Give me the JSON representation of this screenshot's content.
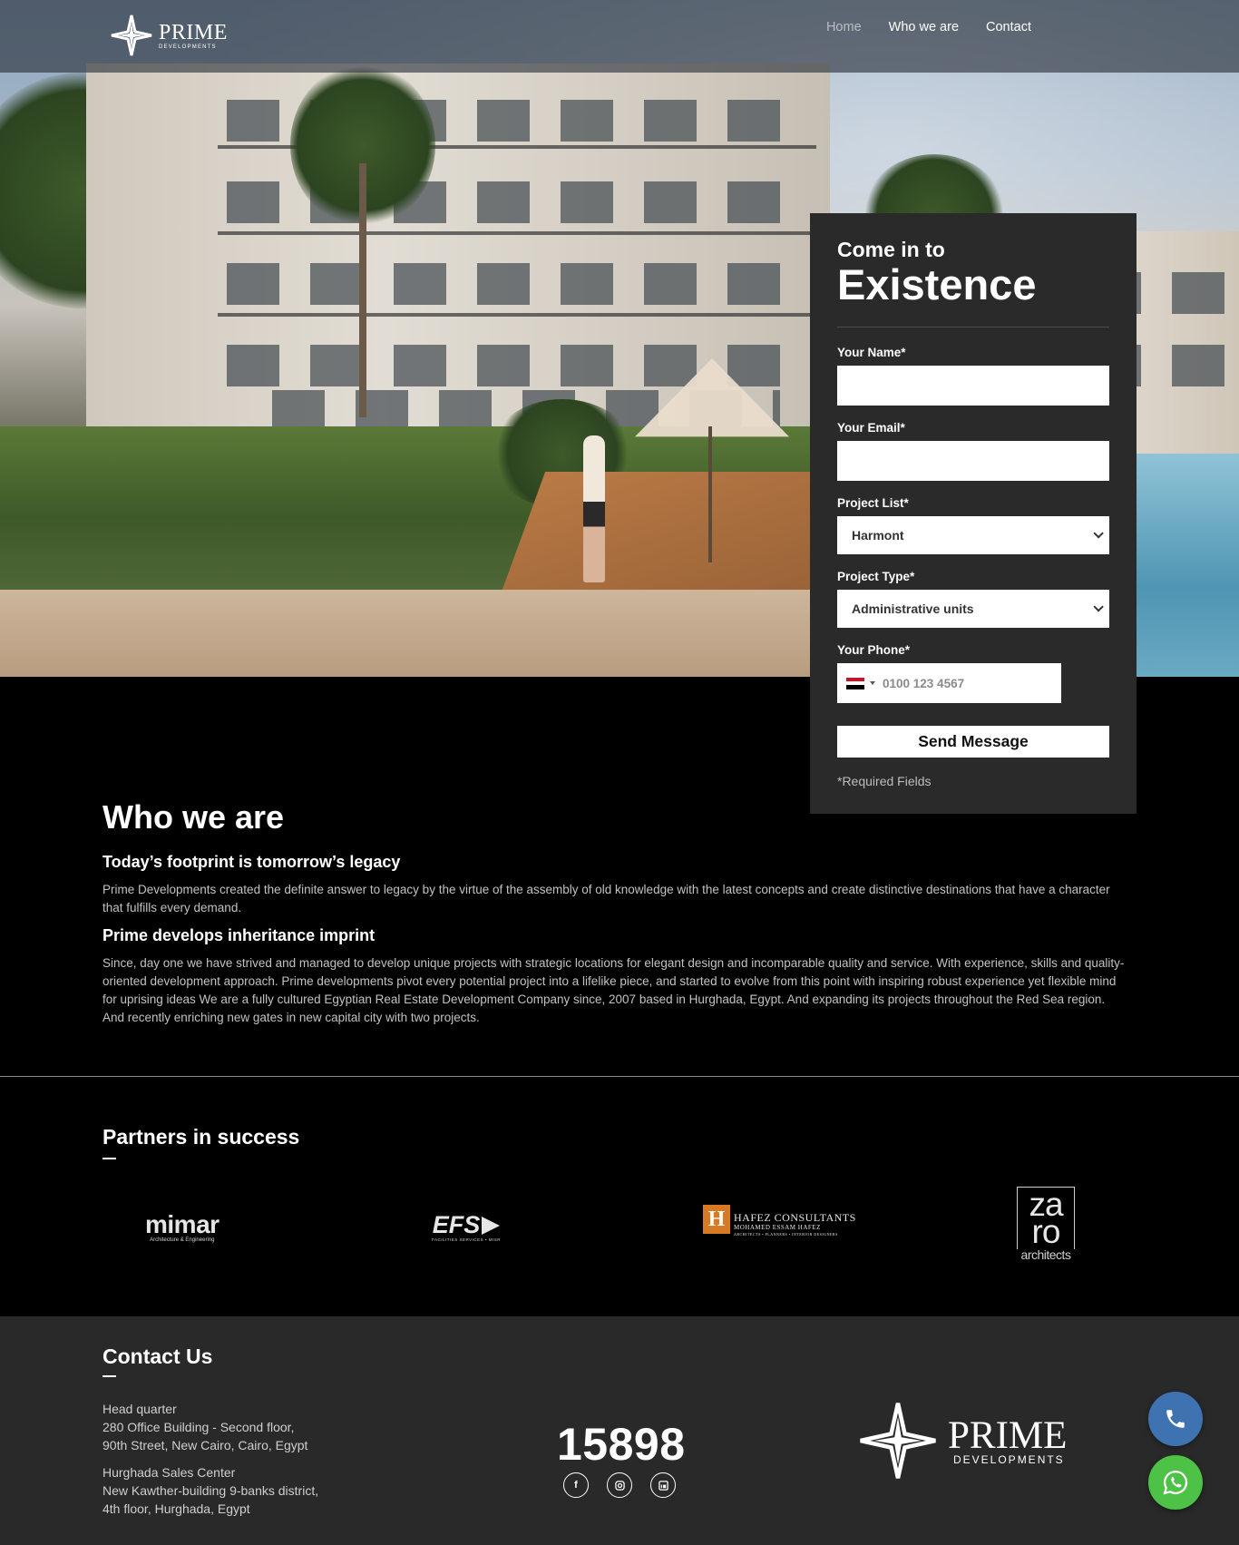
{
  "brand": {
    "name": "PRIME",
    "sub": "DEVELOPMENTS",
    "footer_sub": "DEVELOPMENTS"
  },
  "nav": {
    "items": [
      {
        "label": "Home",
        "active": false
      },
      {
        "label": "Who we are",
        "active": true
      },
      {
        "label": "Contact",
        "active": true
      }
    ]
  },
  "form": {
    "title_small": "Come in to",
    "title_big": "Existence",
    "name_label": "Your Name*",
    "email_label": "Your Email*",
    "project_list_label": "Project List*",
    "project_list_value": "Harmont",
    "project_type_label": "Project Type*",
    "project_type_value": "Administrative units",
    "phone_label": "Your Phone*",
    "phone_placeholder": "0100 123 4567",
    "submit_label": "Send Message",
    "required_note": "*Required Fields"
  },
  "who": {
    "title": "Who we are",
    "heading1": "Today’s footprint is tomorrow’s legacy",
    "para1": "Prime Developments created the definite answer to legacy by the virtue of the assembly of old knowledge with the latest concepts and create distinctive destinations that have a character that fulfills every demand.",
    "heading2": "Prime develops inheritance imprint",
    "para2": "Since, day one we have strived and managed to develop unique projects with strategic locations for elegant design and incomparable quality and service. With experience, skills and quality-oriented development approach. Prime developments pivot every potential project into a lifelike piece, and started to evolve from this point with inspiring robust experience yet flexible mind for uprising ideas We are a fully cultured Egyptian Real Estate Development Company since, 2007 based in Hurghada, Egypt. And expanding its projects throughout the Red Sea region. And recently enriching new gates in new capital city with two projects."
  },
  "partners": {
    "title": "Partners in success",
    "mimar": {
      "name": "mimar",
      "tagline": "Architecture & Engineering"
    },
    "efs": {
      "name": "EFS",
      "tagline": "FACILITIES SERVICES • MISR"
    },
    "hafez": {
      "mark": "H",
      "name": "HAFEZ CONSULTANTS",
      "sub": "MOHAMED ESSAM HAFEZ",
      "tagline": "ARCHITECTS • PLANNERS • INTERIOR DESIGNERS"
    },
    "zaro": {
      "line1": "za",
      "line2": "ro",
      "line3": "architects"
    }
  },
  "contact": {
    "title": "Contact Us",
    "hq_label": "Head quarter",
    "hq_line1": "280 Office Building - Second floor,",
    "hq_line2": "90th Street, New Cairo, Cairo, Egypt",
    "sales_label": "Hurghada Sales Center",
    "sales_line1": "New Kawther-building 9-banks district,",
    "sales_line2": "4th floor, Hurghada, Egypt",
    "hotline": "15898",
    "socials": [
      "facebook-icon",
      "instagram-icon",
      "linkedin-icon"
    ]
  },
  "colors": {
    "form_bg": "#2a2a2a",
    "footer_bg": "#292929",
    "call_button": "#3e72b0",
    "whatsapp_button": "#4dc247",
    "hafez_orange": "#d77a23"
  }
}
